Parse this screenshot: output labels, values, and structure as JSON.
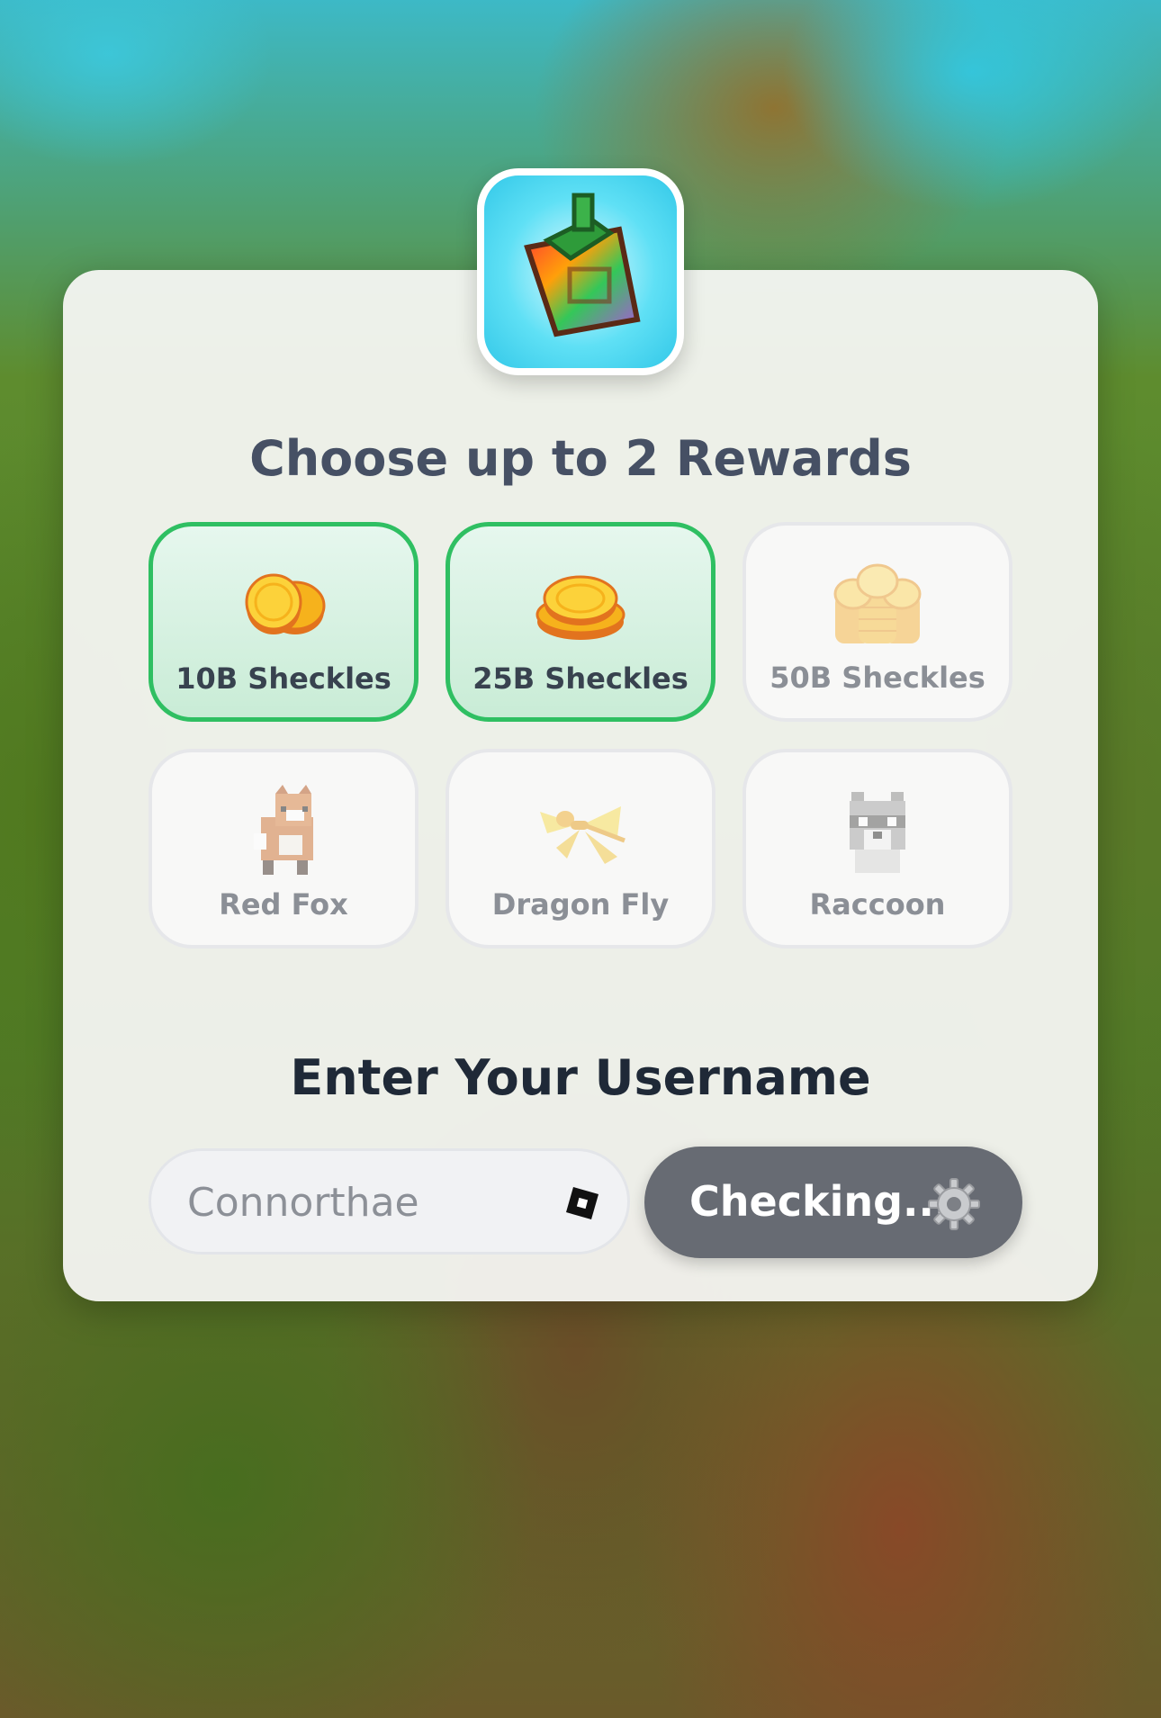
{
  "header": {
    "title": "Choose up to 2 Rewards"
  },
  "rewards": [
    {
      "label": "10B Sheckles",
      "icon": "coin-stack-small-icon",
      "selected": true
    },
    {
      "label": "25B Sheckles",
      "icon": "coin-stack-medium-icon",
      "selected": true
    },
    {
      "label": "50B Sheckles",
      "icon": "coin-stack-large-icon",
      "selected": false
    },
    {
      "label": "Red Fox",
      "icon": "red-fox-icon",
      "selected": false
    },
    {
      "label": "Dragon Fly",
      "icon": "dragonfly-icon",
      "selected": false
    },
    {
      "label": "Raccoon",
      "icon": "raccoon-icon",
      "selected": false
    }
  ],
  "username": {
    "heading": "Enter Your Username",
    "value": "Connorthae",
    "button_label": "Checking..."
  },
  "colors": {
    "selected_border": "#2fbf62",
    "button_bg": "#676b73",
    "title_text": "#465064"
  }
}
